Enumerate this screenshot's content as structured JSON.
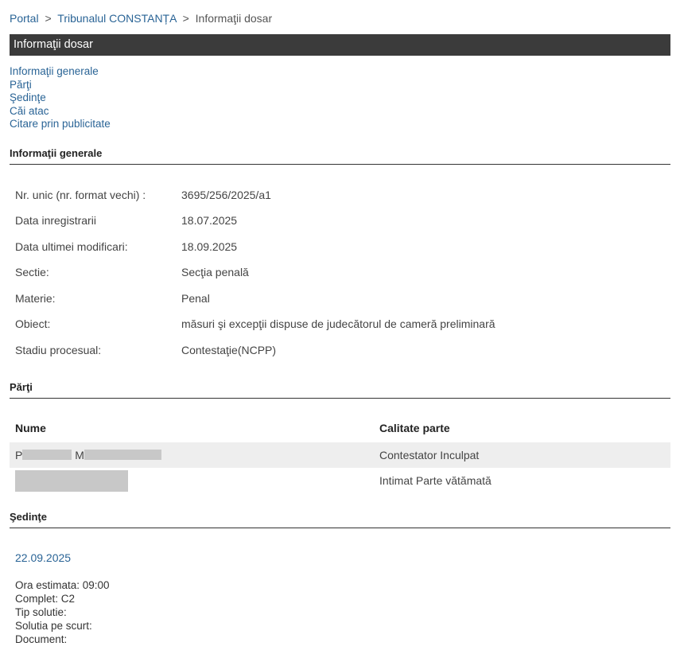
{
  "breadcrumb": {
    "portal": "Portal",
    "sep": ">",
    "court": "Tribunalul CONSTANȚA",
    "current": "Informaţii dosar"
  },
  "title": "Informaţii dosar",
  "toc": [
    "Informaţii generale",
    "Părţi",
    "Şedinţe",
    "Căi atac",
    "Citare prin publicitate"
  ],
  "general": {
    "heading": "Informaţii generale",
    "rows": [
      {
        "label": "Nr. unic (nr. format vechi) :",
        "value": "3695/256/2025/a1"
      },
      {
        "label": "Data inregistrarii",
        "value": "18.07.2025"
      },
      {
        "label": "Data ultimei modificari:",
        "value": "18.09.2025"
      },
      {
        "label": "Sectie:",
        "value": "Secţia penală"
      },
      {
        "label": "Materie:",
        "value": "Penal"
      },
      {
        "label": "Obiect:",
        "value": "măsuri şi excepţii dispuse de judecătorul de cameră preliminară"
      },
      {
        "label": "Stadiu procesual:",
        "value": "Contestaţie(NCPP)"
      }
    ]
  },
  "parties": {
    "heading": "Părţi",
    "col_name": "Nume",
    "col_role": "Calitate parte",
    "rows": [
      {
        "name_initial_1": "P",
        "name_initial_2": "M",
        "role": "Contestator Inculpat"
      },
      {
        "role": "Intimat Parte vătămată"
      }
    ]
  },
  "hearings": {
    "heading": "Şedinţe",
    "date": "22.09.2025",
    "ora": "Ora estimata: 09:00",
    "complet": "Complet: C2",
    "tip": "Tip solutie:",
    "solutia": "Solutia pe scurt:",
    "document": "Document:"
  }
}
